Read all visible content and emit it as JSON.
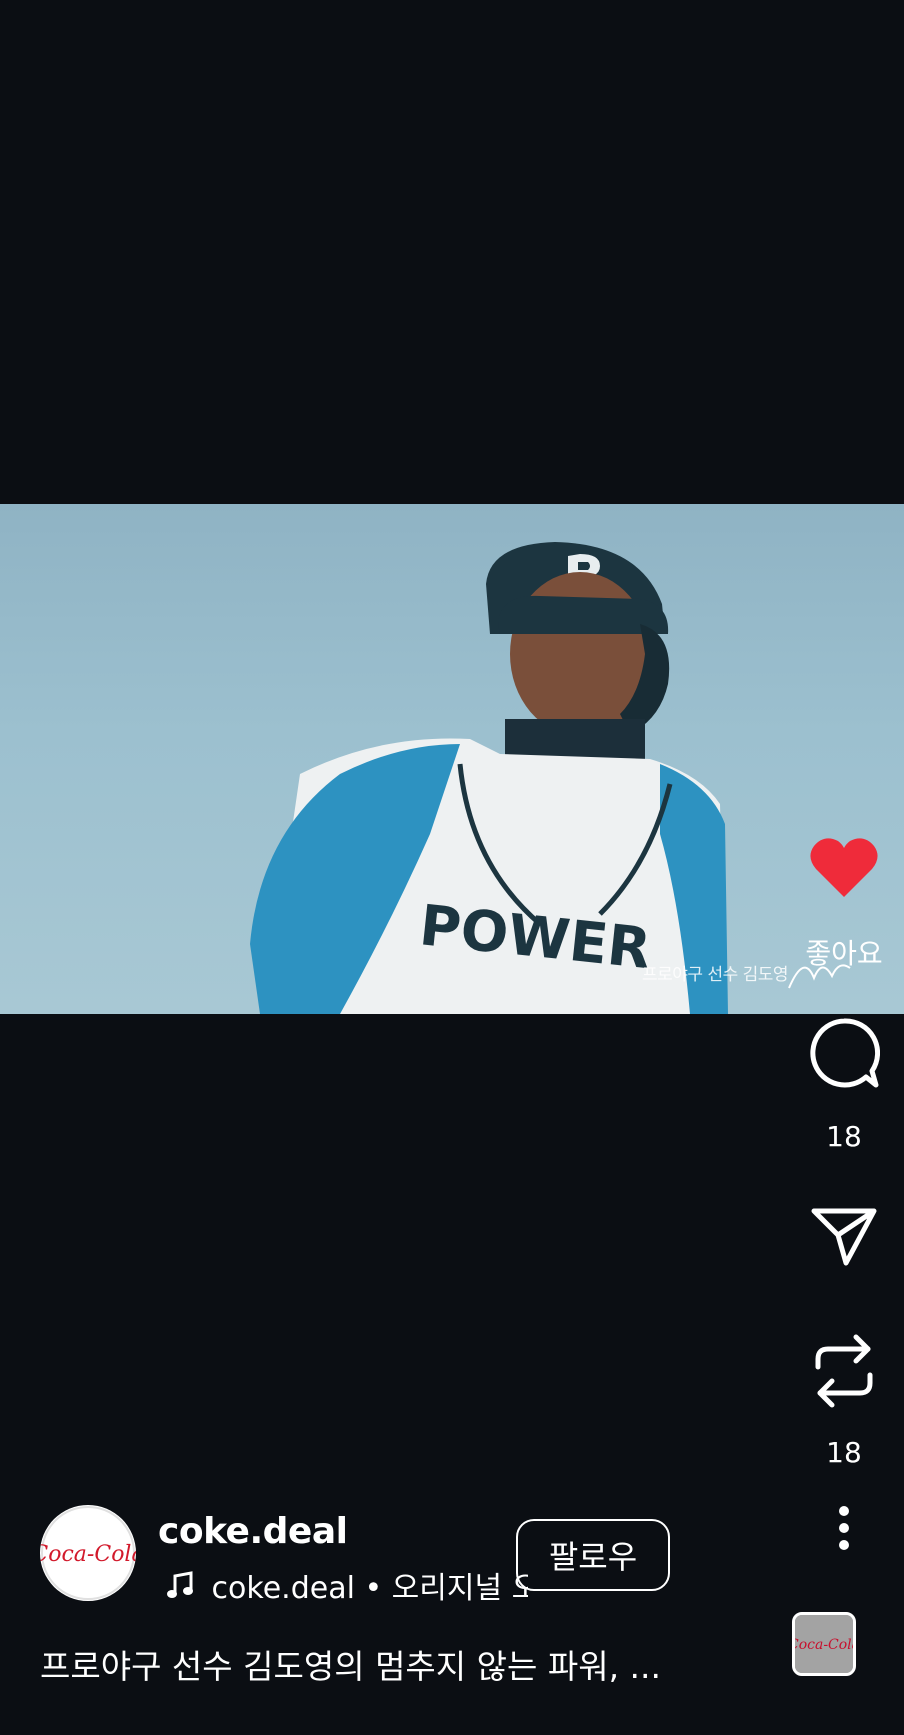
{
  "video": {
    "overlay_caption": "프로야구 선수 김도영",
    "jersey_text": "POWER",
    "helmet_letter": "P"
  },
  "actions": {
    "like_label": "좋아요",
    "comment_count": "18",
    "repost_count": "18"
  },
  "author": {
    "username": "coke.deal",
    "avatar_logo_text": "Coca-Cola",
    "audio": "coke.deal • 오리지널 오디오",
    "follow_label": "팔로우"
  },
  "caption": "프로야구 선수 김도영의 멈추지 않는 파워, ...",
  "colors": {
    "background": "#0b0e13",
    "like_red": "#ef2b3a",
    "coke_red": "#d2192b"
  },
  "icons": [
    "heart-icon",
    "comment-icon",
    "share-icon",
    "repost-icon",
    "more-icon",
    "music-note-icon"
  ]
}
